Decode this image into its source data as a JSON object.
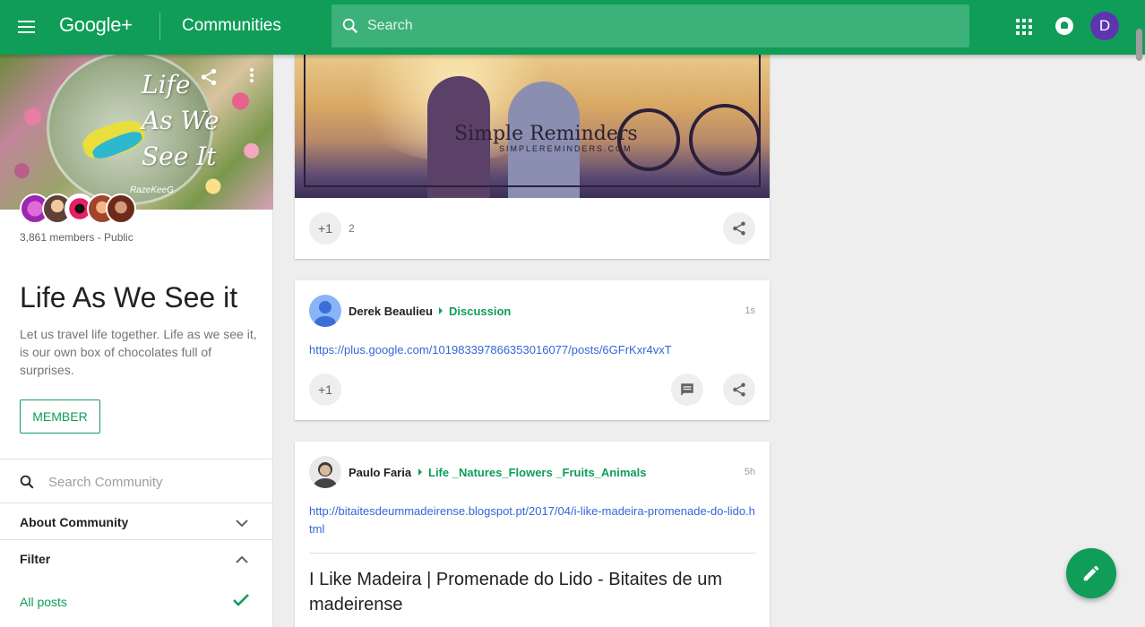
{
  "header": {
    "brand": "Google+",
    "section_title": "Communities",
    "search_placeholder": "Search",
    "account_initial": "D"
  },
  "community": {
    "cover_text_line1": "Life",
    "cover_text_line2": "As We",
    "cover_text_line3": "See It",
    "cover_signature": "RazeKeeG",
    "member_count": "3,861 members - Public",
    "title": "Life As We See it",
    "description": "Let us travel life together. Life as we see it, is our own box of chocolates full of surprises.",
    "member_button": "MEMBER",
    "search_placeholder": "Search Community",
    "about_label": "About Community",
    "filter_label": "Filter",
    "all_posts_label": "All posts"
  },
  "posts": [
    {
      "image_title": "Simple Reminders",
      "image_subtitle": "SIMPLEREMINDERS.COM",
      "plus_label": "+1",
      "plus_count": "2"
    },
    {
      "author": "Derek Beaulieu",
      "category": "Discussion",
      "time": "1s",
      "link": "https://plus.google.com/101983397866353016077/posts/6GFrKxr4vxT",
      "plus_label": "+1"
    },
    {
      "author": "Paulo Faria",
      "category": "Life _Natures_Flowers _Fruits_Animals",
      "time": "5h",
      "link": "http://bitaitesdeummadeirense.blogspot.pt/2017/04/i-like-madeira-promenade-do-lido.html",
      "preview_title": "I Like Madeira | Promenade do Lido - Bitaites de um madeirense"
    }
  ],
  "colors": {
    "brand_green": "#0f9d58",
    "link_blue": "#3367d6",
    "account_purple": "#5e35b1"
  },
  "icons": [
    "menu-icon",
    "search-icon",
    "apps-icon",
    "notifications-icon",
    "share-icon",
    "more-vert-icon",
    "chevron-down-icon",
    "chevron-up-icon",
    "check-icon",
    "comment-icon",
    "edit-icon"
  ]
}
